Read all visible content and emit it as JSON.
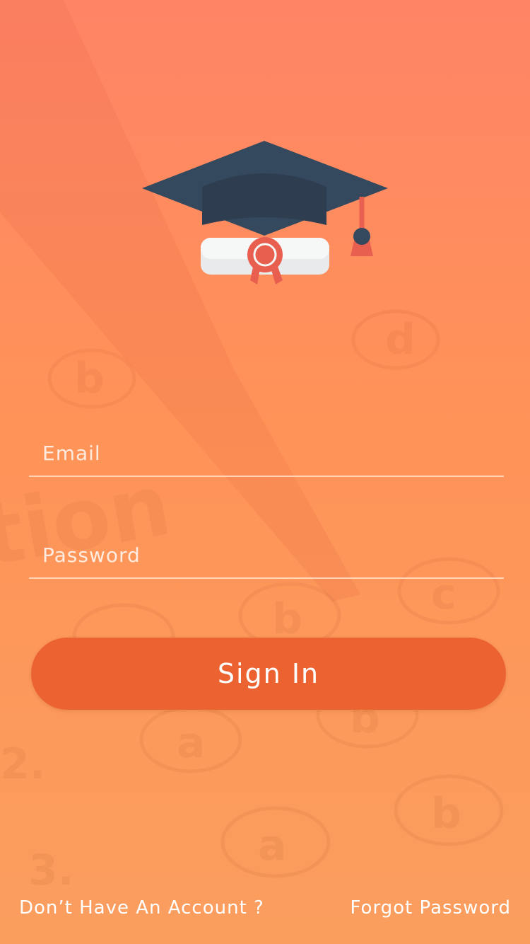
{
  "form": {
    "email_placeholder": "Email",
    "password_placeholder": "Password",
    "signin_label": "Sign In"
  },
  "footer": {
    "signup_link": "Don’t Have An Account ?",
    "forgot_link": "Forgot Password"
  },
  "colors": {
    "bg_top": "#ff8466",
    "bg_bottom": "#fa9e5e",
    "button": "#ec6331",
    "cap": "#34495e",
    "ribbon": "#e85f4f"
  },
  "icons": {
    "logo": "graduation-cap-with-diploma-icon"
  }
}
